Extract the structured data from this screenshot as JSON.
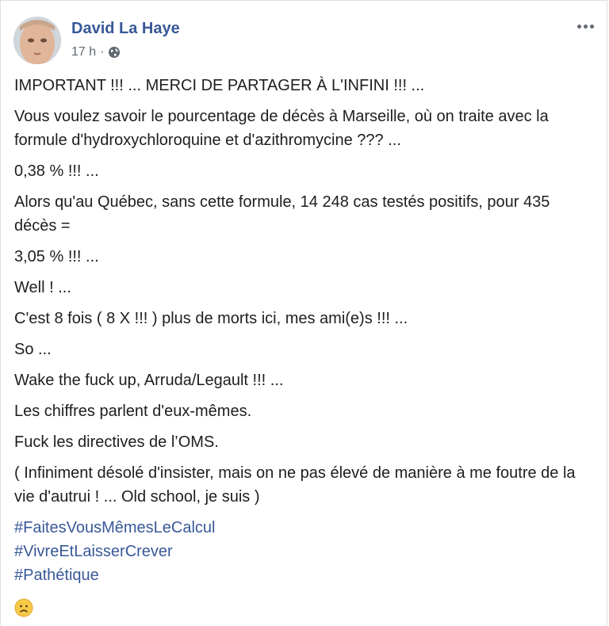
{
  "author": {
    "name": "David La Haye"
  },
  "meta": {
    "time": "17 h",
    "separator": "·",
    "audience_icon": "globe-icon"
  },
  "menu": {
    "icon": "more-options-icon"
  },
  "post": {
    "paragraphs": [
      "IMPORTANT !!! ... MERCI DE PARTAGER À L'INFINI !!! ...",
      "Vous voulez savoir le pourcentage de décès à Marseille, où on traite avec la formule d'hydroxychloroquine et d'azithromycine ??? ...",
      "0,38 % !!! ...",
      "Alors qu'au Québec, sans cette formule, 14 248 cas testés positifs, pour 435 décès =",
      "3,05 % !!! ...",
      "Well ! ...",
      "C'est 8 fois ( 8 X !!! ) plus de morts ici, mes ami(e)s !!! ...",
      "So ...",
      "Wake the fuck up, Arruda/Legault !!! ...",
      "Les chiffres parlent d'eux-mêmes.",
      "Fuck les directives de l’OMS.",
      "( Infiniment désolé d'insister, mais on ne pas élevé de manière à me foutre de la vie d'autrui ! ... Old school, je suis )"
    ],
    "hashtags": [
      "#FaitesVousMêmesLeCalcul",
      "#VivreEtLaisserCrever",
      "#Pathétique"
    ],
    "emoji": "frowning-face-emoji"
  },
  "colors": {
    "link": "#385898",
    "text": "#1c1e21",
    "muted": "#606770"
  }
}
